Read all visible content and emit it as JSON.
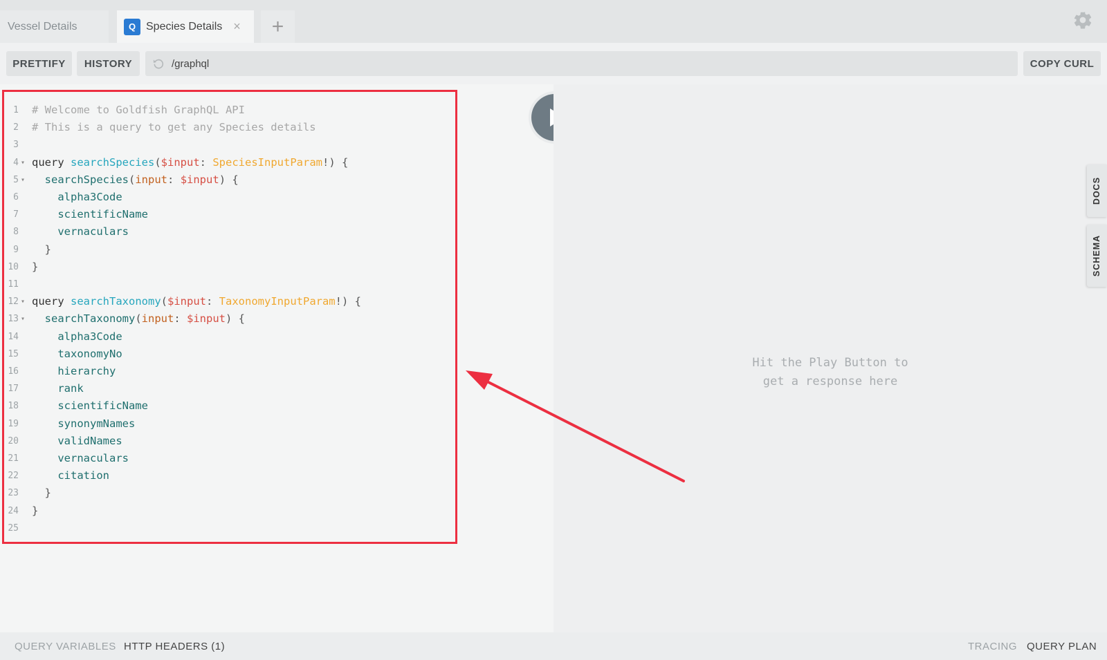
{
  "tabs": {
    "inactive_label": "Vessel Details",
    "active_label": "Species Details",
    "active_badge": "Q",
    "close_glyph": "×",
    "add_glyph": "+"
  },
  "toolbar": {
    "prettify": "PRETTIFY",
    "history": "HISTORY",
    "endpoint": "/graphql",
    "copy_curl": "COPY CURL"
  },
  "editor": {
    "lines": [
      {
        "n": "1",
        "fold": "",
        "tokens": [
          [
            "c-comment",
            "# Welcome to Goldfish GraphQL API"
          ]
        ]
      },
      {
        "n": "2",
        "fold": "",
        "tokens": [
          [
            "c-comment",
            "# This is a query to get any Species details"
          ]
        ]
      },
      {
        "n": "3",
        "fold": "",
        "tokens": []
      },
      {
        "n": "4",
        "fold": "▾",
        "tokens": [
          [
            "c-kw",
            "query "
          ],
          [
            "c-def",
            "searchSpecies"
          ],
          [
            "c-punc",
            "("
          ],
          [
            "c-var",
            "$input"
          ],
          [
            "c-punc",
            ": "
          ],
          [
            "c-type",
            "SpeciesInputParam"
          ],
          [
            "c-punc",
            "!) {"
          ]
        ]
      },
      {
        "n": "5",
        "fold": "▾",
        "tokens": [
          [
            "c-punc",
            "  "
          ],
          [
            "c-field",
            "searchSpecies"
          ],
          [
            "c-punc",
            "("
          ],
          [
            "c-arg",
            "input"
          ],
          [
            "c-punc",
            ": "
          ],
          [
            "c-var",
            "$input"
          ],
          [
            "c-punc",
            ") {"
          ]
        ]
      },
      {
        "n": "6",
        "fold": "",
        "tokens": [
          [
            "c-field",
            "    alpha3Code"
          ]
        ]
      },
      {
        "n": "7",
        "fold": "",
        "tokens": [
          [
            "c-field",
            "    scientificName"
          ]
        ]
      },
      {
        "n": "8",
        "fold": "",
        "tokens": [
          [
            "c-field",
            "    vernaculars"
          ]
        ]
      },
      {
        "n": "9",
        "fold": "",
        "tokens": [
          [
            "c-punc",
            "  }"
          ]
        ]
      },
      {
        "n": "10",
        "fold": "",
        "tokens": [
          [
            "c-punc",
            "}"
          ]
        ]
      },
      {
        "n": "11",
        "fold": "",
        "tokens": []
      },
      {
        "n": "12",
        "fold": "▾",
        "tokens": [
          [
            "c-kw",
            "query "
          ],
          [
            "c-def",
            "searchTaxonomy"
          ],
          [
            "c-punc",
            "("
          ],
          [
            "c-var",
            "$input"
          ],
          [
            "c-punc",
            ": "
          ],
          [
            "c-type",
            "TaxonomyInputParam"
          ],
          [
            "c-punc",
            "!) {"
          ]
        ]
      },
      {
        "n": "13",
        "fold": "▾",
        "tokens": [
          [
            "c-punc",
            "  "
          ],
          [
            "c-field",
            "searchTaxonomy"
          ],
          [
            "c-punc",
            "("
          ],
          [
            "c-arg",
            "input"
          ],
          [
            "c-punc",
            ": "
          ],
          [
            "c-var",
            "$input"
          ],
          [
            "c-punc",
            ") {"
          ]
        ]
      },
      {
        "n": "14",
        "fold": "",
        "tokens": [
          [
            "c-field",
            "    alpha3Code"
          ]
        ]
      },
      {
        "n": "15",
        "fold": "",
        "tokens": [
          [
            "c-field",
            "    taxonomyNo"
          ]
        ]
      },
      {
        "n": "16",
        "fold": "",
        "tokens": [
          [
            "c-field",
            "    hierarchy"
          ]
        ]
      },
      {
        "n": "17",
        "fold": "",
        "tokens": [
          [
            "c-field",
            "    rank"
          ]
        ]
      },
      {
        "n": "18",
        "fold": "",
        "tokens": [
          [
            "c-field",
            "    scientificName"
          ]
        ]
      },
      {
        "n": "19",
        "fold": "",
        "tokens": [
          [
            "c-field",
            "    synonymNames"
          ]
        ]
      },
      {
        "n": "20",
        "fold": "",
        "tokens": [
          [
            "c-field",
            "    validNames"
          ]
        ]
      },
      {
        "n": "21",
        "fold": "",
        "tokens": [
          [
            "c-field",
            "    vernaculars"
          ]
        ]
      },
      {
        "n": "22",
        "fold": "",
        "tokens": [
          [
            "c-field",
            "    citation"
          ]
        ]
      },
      {
        "n": "23",
        "fold": "",
        "tokens": [
          [
            "c-punc",
            "  }"
          ]
        ]
      },
      {
        "n": "24",
        "fold": "",
        "tokens": [
          [
            "c-punc",
            "}"
          ]
        ]
      },
      {
        "n": "25",
        "fold": "",
        "tokens": []
      }
    ]
  },
  "result": {
    "hint_line1": "Hit the Play Button to",
    "hint_line2": "get a response here"
  },
  "side_tabs": {
    "docs": "DOCS",
    "schema": "SCHEMA"
  },
  "bottom": {
    "query_variables": "QUERY VARIABLES",
    "http_headers": "HTTP HEADERS (1)",
    "tracing": "TRACING",
    "query_plan": "QUERY PLAN"
  },
  "icons": {
    "settings": "gear-icon",
    "reload": "reload-icon",
    "play": "play-icon",
    "close": "close-icon",
    "add": "plus-icon"
  },
  "colors": {
    "annotation": "#ec2f41",
    "badge": "#2a7bd3",
    "play_button": "#6e7b84"
  }
}
